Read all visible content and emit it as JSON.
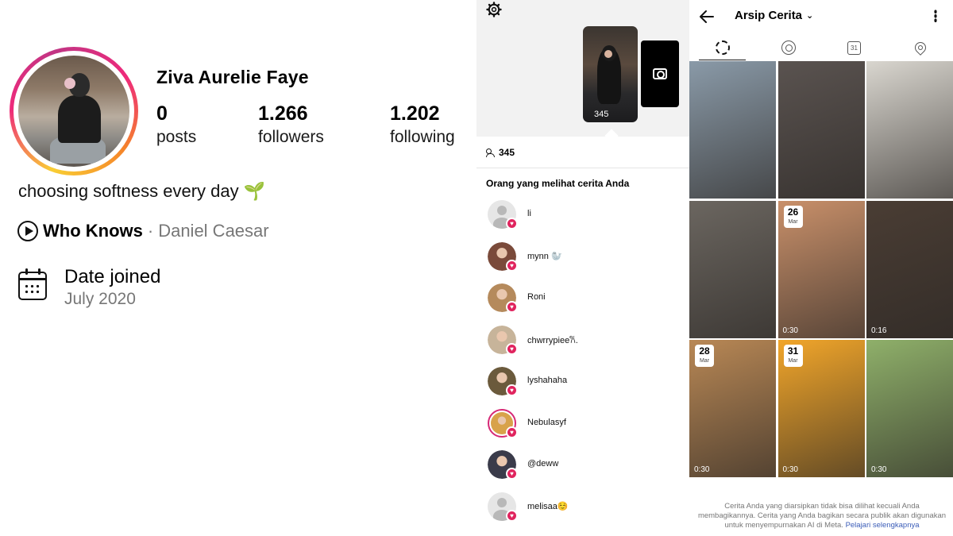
{
  "profile": {
    "name": "Ziva Aurelie Faye",
    "stats": [
      {
        "value": "0",
        "label": "posts"
      },
      {
        "value": "1.266",
        "label": "followers"
      },
      {
        "value": "1.202",
        "label": "following"
      }
    ],
    "bio": "choosing softness every day",
    "bio_emoji": "🌱",
    "music": {
      "song": "Who Knows",
      "separator": "·",
      "artist": "Daniel Caesar"
    },
    "joined": {
      "title": "Date joined",
      "date": "July 2020"
    }
  },
  "story": {
    "thumb_views": "345",
    "views": "345",
    "viewers_title": "Orang yang melihat cerita Anda",
    "viewers": [
      {
        "name": "li",
        "avatar": "blank"
      },
      {
        "name": "mynn 🦭",
        "avatar": "#7a4a3a"
      },
      {
        "name": "Roni",
        "avatar": "#b58a5c"
      },
      {
        "name": "chwrrypiee𐙚.",
        "avatar": "#c7b49a"
      },
      {
        "name": "lyshahaha",
        "avatar": "#6b5a3c"
      },
      {
        "name": "Nebulasyf",
        "avatar": "#d8a24a",
        "ring": true
      },
      {
        "name": "@deww",
        "avatar": "#3a3b4a"
      },
      {
        "name": "melisaa☺️",
        "avatar": "blank"
      }
    ]
  },
  "archive": {
    "title": "Arsip Cerita",
    "tabs": [
      "story-archive",
      "memories",
      "calendar",
      "location"
    ],
    "calendar_tab_text": "31",
    "cells": [
      {
        "badge_day": "",
        "badge_month": "",
        "duration": "",
        "bg": "#8a9aa8"
      },
      {
        "badge_day": "",
        "badge_month": "",
        "duration": "",
        "bg": "#5a5350"
      },
      {
        "badge_day": "",
        "badge_month": "",
        "duration": "",
        "bg": "#d9d6cf"
      },
      {
        "badge_day": "",
        "badge_month": "",
        "duration": "",
        "bg": "#6b6660"
      },
      {
        "badge_day": "26",
        "badge_month": "Mar",
        "duration": "0:30",
        "bg": "#c9906a"
      },
      {
        "badge_day": "",
        "badge_month": "",
        "duration": "0:16",
        "bg": "#4a3d34"
      },
      {
        "badge_day": "28",
        "badge_month": "Mar",
        "duration": "0:30",
        "bg": "#b98855"
      },
      {
        "badge_day": "31",
        "badge_month": "Mar",
        "duration": "0:30",
        "bg": "#f2a62a"
      },
      {
        "badge_day": "",
        "badge_month": "",
        "duration": "0:30",
        "bg": "#8fb06a"
      }
    ],
    "footer_text": "Cerita Anda yang diarsipkan tidak bisa dilihat kecuali Anda membagikannya. Cerita yang Anda bagikan secara publik akan digunakan untuk menyempurnakan AI di Meta.",
    "footer_link": "Pelajari selengkapnya"
  }
}
